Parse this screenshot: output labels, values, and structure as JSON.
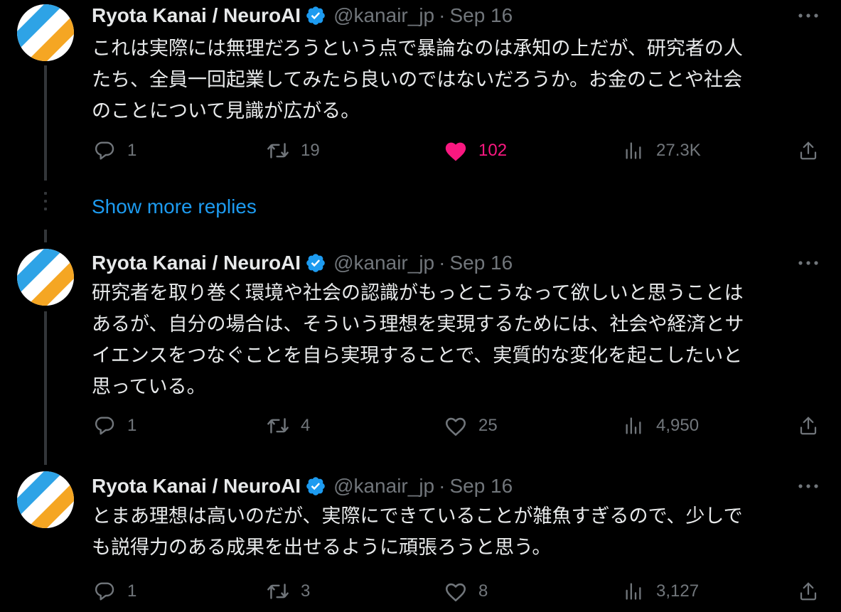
{
  "colors": {
    "background": "#000000",
    "text_primary": "#e7e9ea",
    "text_secondary": "#71767b",
    "accent_link": "#1d9bf0",
    "like_active": "#f91880",
    "verified_badge": "#1d9bf0",
    "avatar_blue": "#2ea3e6",
    "avatar_orange": "#f5a623"
  },
  "author": {
    "name": "Ryota Kanai / NeuroAI",
    "handle": "@kanair_jp",
    "verified_icon": "verified-badge-icon"
  },
  "show_more_replies": "Show more replies",
  "tweets": [
    {
      "date": "Sep 16",
      "dot": "·",
      "lines": [
        "これは実際には無理だろうという点で暴論なのは承知の上だが、研究者の人",
        "たち、全員一回起業してみたら良いのではないだろうか。お金のことや社会",
        "のことについて見識が広がる。"
      ],
      "replies": "1",
      "reposts": "19",
      "likes": "102",
      "liked": true,
      "views": "27.3K"
    },
    {
      "date": "Sep 16",
      "dot": "·",
      "lines": [
        "研究者を取り巻く環境や社会の認識がもっとこうなって欲しいと思うことは",
        "あるが、自分の場合は、そういう理想を実現するためには、社会や経済とサ",
        "イエンスをつなぐことを自ら実現することで、実質的な変化を起こしたいと",
        "思っている。"
      ],
      "replies": "1",
      "reposts": "4",
      "likes": "25",
      "liked": false,
      "views": "4,950"
    },
    {
      "date": "Sep 16",
      "dot": "·",
      "lines": [
        "とまあ理想は高いのだが、実際にできていることが雑魚すぎるので、少しで",
        "も説得力のある成果を出せるように頑張ろうと思う。"
      ],
      "replies": "1",
      "reposts": "3",
      "likes": "8",
      "liked": false,
      "views": "3,127"
    }
  ]
}
